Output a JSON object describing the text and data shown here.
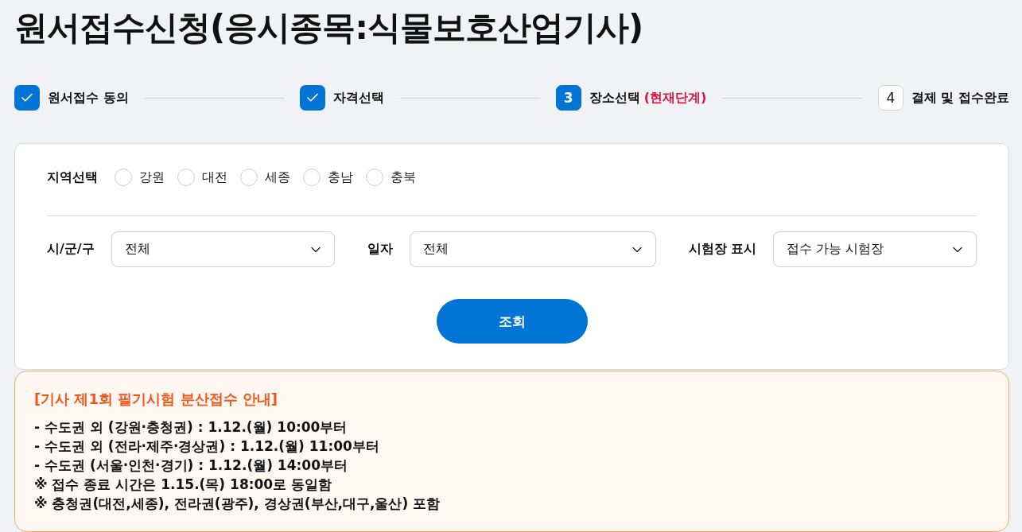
{
  "page_title": "원서접수신청(응시종목:식물보호산업기사)",
  "steps": [
    {
      "kind": "done",
      "label": "원서접수 동의"
    },
    {
      "kind": "done",
      "label": "자격선택"
    },
    {
      "kind": "current",
      "number": "3",
      "label": "장소선택",
      "note": "(현재단계)"
    },
    {
      "kind": "pending",
      "number": "4",
      "label": "결제 및 접수완료"
    }
  ],
  "region": {
    "label": "지역선택",
    "options": [
      {
        "label": "강원",
        "selected": false
      },
      {
        "label": "대전",
        "selected": false
      },
      {
        "label": "세종",
        "selected": false
      },
      {
        "label": "충남",
        "selected": false
      },
      {
        "label": "충북",
        "selected": false
      }
    ]
  },
  "filters": [
    {
      "label": "시/군/구",
      "value": "전체"
    },
    {
      "label": "일자",
      "value": "전체"
    },
    {
      "label": "시험장 표시",
      "value": "접수 가능 시험장"
    }
  ],
  "search_button": "조회",
  "notice": {
    "title": "[기사 제1회 필기시험 분산접수 안내]",
    "lines": [
      "- 수도권 외 (강원·충청권) : 1.12.(월) 10:00부터",
      "- 수도권 외 (전라·제주·경상권) : 1.12.(월) 11:00부터",
      "- 수도권 (서울·인천·경기) : 1.12.(월) 14:00부터",
      "※ 접수 종료 시간은 1.15.(목) 18:00로 동일함",
      "※ 충청권(대전,세종), 전라권(광주), 경상권(부산,대구,울산) 포함"
    ]
  }
}
